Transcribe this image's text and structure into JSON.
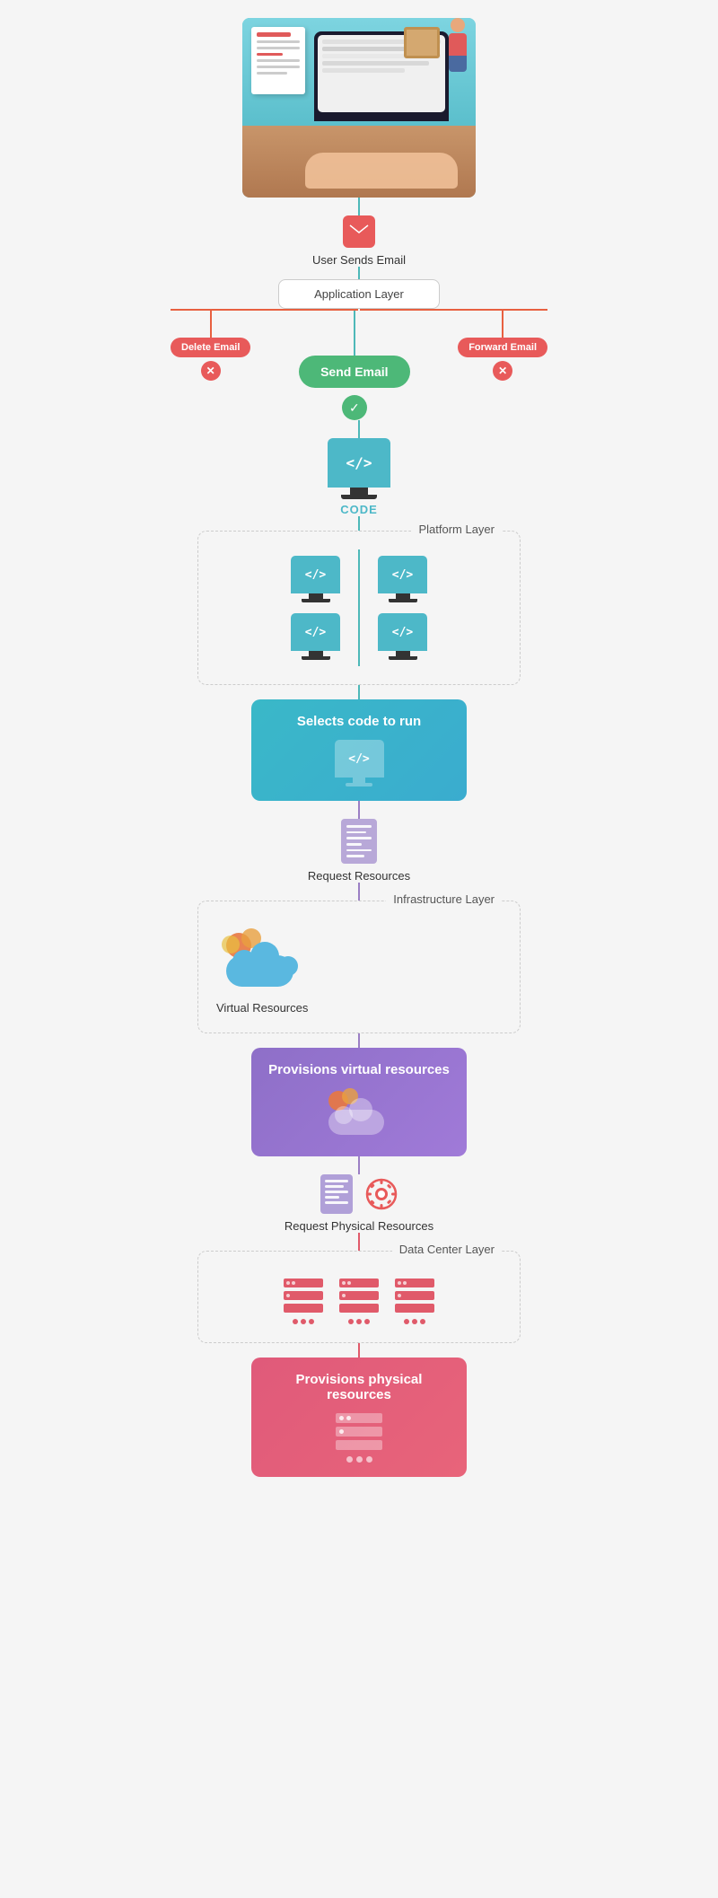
{
  "hero": {
    "alt": "Person working on laptop illustration"
  },
  "flow": {
    "user_sends_email": "User Sends Email",
    "application_layer": "Application Layer",
    "delete_email": "Delete Email",
    "forward_email": "Forward Email",
    "send_email": "Send Email",
    "code_label": "CODE",
    "platform_layer": "Platform Layer",
    "selects_code": "Selects code to run",
    "request_resources": "Request Resources",
    "infrastructure_layer": "Infrastructure Layer",
    "virtual_resources": "Virtual Resources",
    "provisions_virtual": "Provisions virtual resources",
    "request_physical": "Request Physical Resources",
    "data_center_layer": "Data Center Layer",
    "provisions_physical": "Provisions physical resources"
  },
  "icons": {
    "email": "✉",
    "code": "</>",
    "check": "✓",
    "x": "✕"
  },
  "colors": {
    "teal": "#4db8c8",
    "green": "#4db878",
    "red_btn": "#e85a5a",
    "orange_line": "#e86040",
    "purple": "#9b7fc4",
    "pink": "#e05a7a",
    "monitor_bg": "#4db8c8"
  }
}
